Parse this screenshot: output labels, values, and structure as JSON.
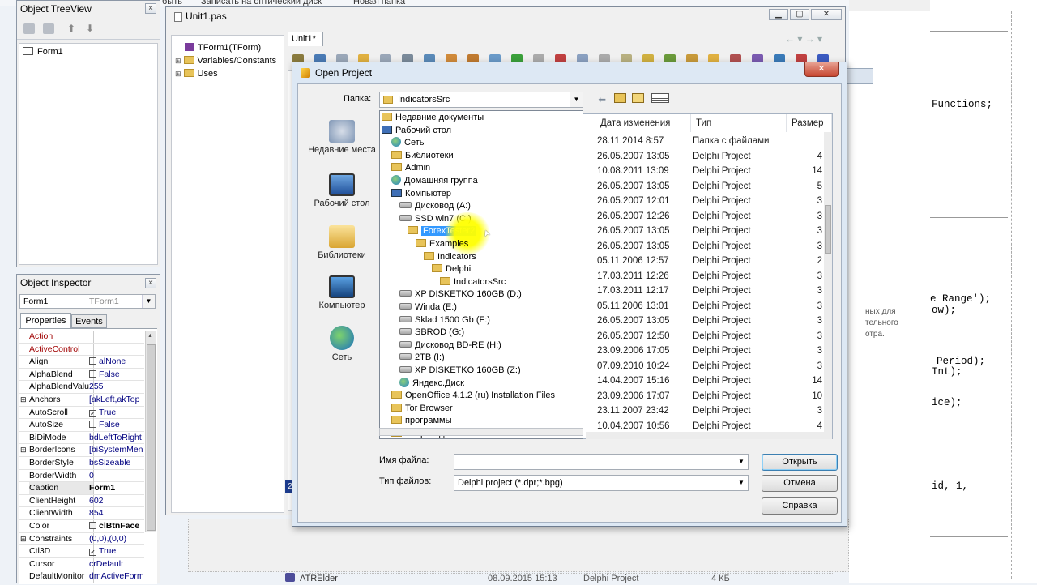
{
  "top_strip": {
    "left_fragment": "быть",
    "write_disc": "Записать на оптический диск",
    "new_folder": "Новая папка"
  },
  "tree_view": {
    "title": "Object TreeView",
    "items": [
      "Form1"
    ]
  },
  "unit_window": {
    "title": "Unit1.pas",
    "tab": "Unit1*",
    "explorer_items": [
      "TForm1(TForm)",
      "Variables/Constants",
      "Uses"
    ],
    "right_code": [
      "Functions;",
      "e Range');",
      "ow);",
      "Period);",
      "Int);",
      "ice);",
      "id, 1,"
    ],
    "right_hint": [
      "ных для",
      "тельного",
      "отра."
    ]
  },
  "object_inspector": {
    "title": "Object Inspector",
    "selector_value": "Form1",
    "selector_type": "TForm1",
    "tabs": [
      "Properties",
      "Events"
    ],
    "properties": [
      {
        "k": "Action",
        "v": "",
        "red": true
      },
      {
        "k": "ActiveControl",
        "v": "",
        "red": true
      },
      {
        "k": "Align",
        "v": "alNone"
      },
      {
        "k": "AlphaBlend",
        "v": "False"
      },
      {
        "k": "AlphaBlendValu",
        "v": "255"
      },
      {
        "k": "Anchors",
        "v": "[akLeft,akTop"
      },
      {
        "k": "AutoScroll",
        "v": "True"
      },
      {
        "k": "AutoSize",
        "v": "False"
      },
      {
        "k": "BiDiMode",
        "v": "bdLeftToRight"
      },
      {
        "k": "BorderIcons",
        "v": "[biSystemMen"
      },
      {
        "k": "BorderStyle",
        "v": "bsSizeable"
      },
      {
        "k": "BorderWidth",
        "v": "0"
      },
      {
        "k": "Caption",
        "v": "Form1"
      },
      {
        "k": "ClientHeight",
        "v": "602"
      },
      {
        "k": "ClientWidth",
        "v": "854"
      },
      {
        "k": "Color",
        "v": "clBtnFace"
      },
      {
        "k": "Constraints",
        "v": "(0,0),(0,0)"
      },
      {
        "k": "Ctl3D",
        "v": "True"
      },
      {
        "k": "Cursor",
        "v": "crDefault"
      },
      {
        "k": "DefaultMonitor",
        "v": "dmActiveForm"
      }
    ]
  },
  "dialog": {
    "title": "Open Project",
    "folder_label": "Папка:",
    "folder_value": "IndicatorsSrc",
    "places": [
      "Недавние места",
      "Рабочий стол",
      "Библиотеки",
      "Компьютер",
      "Сеть"
    ],
    "dropdown": [
      "Недавние документы",
      "Рабочий стол",
      "Сеть",
      "Библиотеки",
      "Admin",
      "Домашняя группа",
      "Компьютер",
      "Дисковод (A:)",
      "SSD win7 (C:)",
      "ForexTester2",
      "Examples",
      "Indicators",
      "Delphi",
      "IndicatorsSrc",
      "XP DISKETKO 160GB (D:)",
      "Winda (E:)",
      "Sklad 1500 Gb (F:)",
      "SBROD (G:)",
      "Дисковод BD-RE (H:)",
      "2TB (I:)",
      "XP DISKETKO 160GB (Z:)",
      "Яндекс.Диск",
      "OpenOffice 4.1.2 (ru) Installation Files",
      "Tor Browser",
      "программы",
      "Старые данные Firefox"
    ],
    "columns": [
      "Дата изменения",
      "Тип",
      "Размер"
    ],
    "rows": [
      {
        "date": "28.11.2014 8:57",
        "type": "Папка с файлами",
        "size": ""
      },
      {
        "date": "26.05.2007 13:05",
        "type": "Delphi Project",
        "size": "4"
      },
      {
        "date": "10.08.2011 13:09",
        "type": "Delphi Project",
        "size": "14"
      },
      {
        "date": "26.05.2007 13:05",
        "type": "Delphi Project",
        "size": "5"
      },
      {
        "date": "26.05.2007 12:01",
        "type": "Delphi Project",
        "size": "3"
      },
      {
        "date": "26.05.2007 12:26",
        "type": "Delphi Project",
        "size": "3"
      },
      {
        "date": "26.05.2007 13:05",
        "type": "Delphi Project",
        "size": "3"
      },
      {
        "date": "26.05.2007 13:05",
        "type": "Delphi Project",
        "size": "3"
      },
      {
        "date": "05.11.2006 12:57",
        "type": "Delphi Project",
        "size": "2"
      },
      {
        "date": "17.03.2011 12:26",
        "type": "Delphi Project",
        "size": "3"
      },
      {
        "date": "17.03.2011 12:17",
        "type": "Delphi Project",
        "size": "3"
      },
      {
        "date": "05.11.2006 13:01",
        "type": "Delphi Project",
        "size": "3"
      },
      {
        "date": "26.05.2007 13:05",
        "type": "Delphi Project",
        "size": "3"
      },
      {
        "date": "26.05.2007 12:50",
        "type": "Delphi Project",
        "size": "3"
      },
      {
        "date": "23.09.2006 17:05",
        "type": "Delphi Project",
        "size": "3"
      },
      {
        "date": "07.09.2010 10:24",
        "type": "Delphi Project",
        "size": "3"
      },
      {
        "date": "14.04.2007 15:16",
        "type": "Delphi Project",
        "size": "14"
      },
      {
        "date": "23.09.2006 17:07",
        "type": "Delphi Project",
        "size": "10"
      },
      {
        "date": "23.11.2007 23:42",
        "type": "Delphi Project",
        "size": "3"
      },
      {
        "date": "10.04.2007 10:56",
        "type": "Delphi Project",
        "size": "4"
      }
    ],
    "filename_label": "Имя файла:",
    "filename_value": "",
    "filetype_label": "Тип файлов:",
    "filetype_value": "Delphi project (*.dpr;*.bpg)",
    "open_btn": "Открыть",
    "cancel_btn": "Отмена",
    "help_btn": "Справка"
  },
  "bottom_row": {
    "name": "ATRElder",
    "date": "08.09.2015 15:13",
    "type": "Delphi Project",
    "size": "4 КБ"
  },
  "colors": {
    "highlight": "#3399ff",
    "cursor_glow": "#ffff00",
    "inspector_red": "#8b0000"
  }
}
